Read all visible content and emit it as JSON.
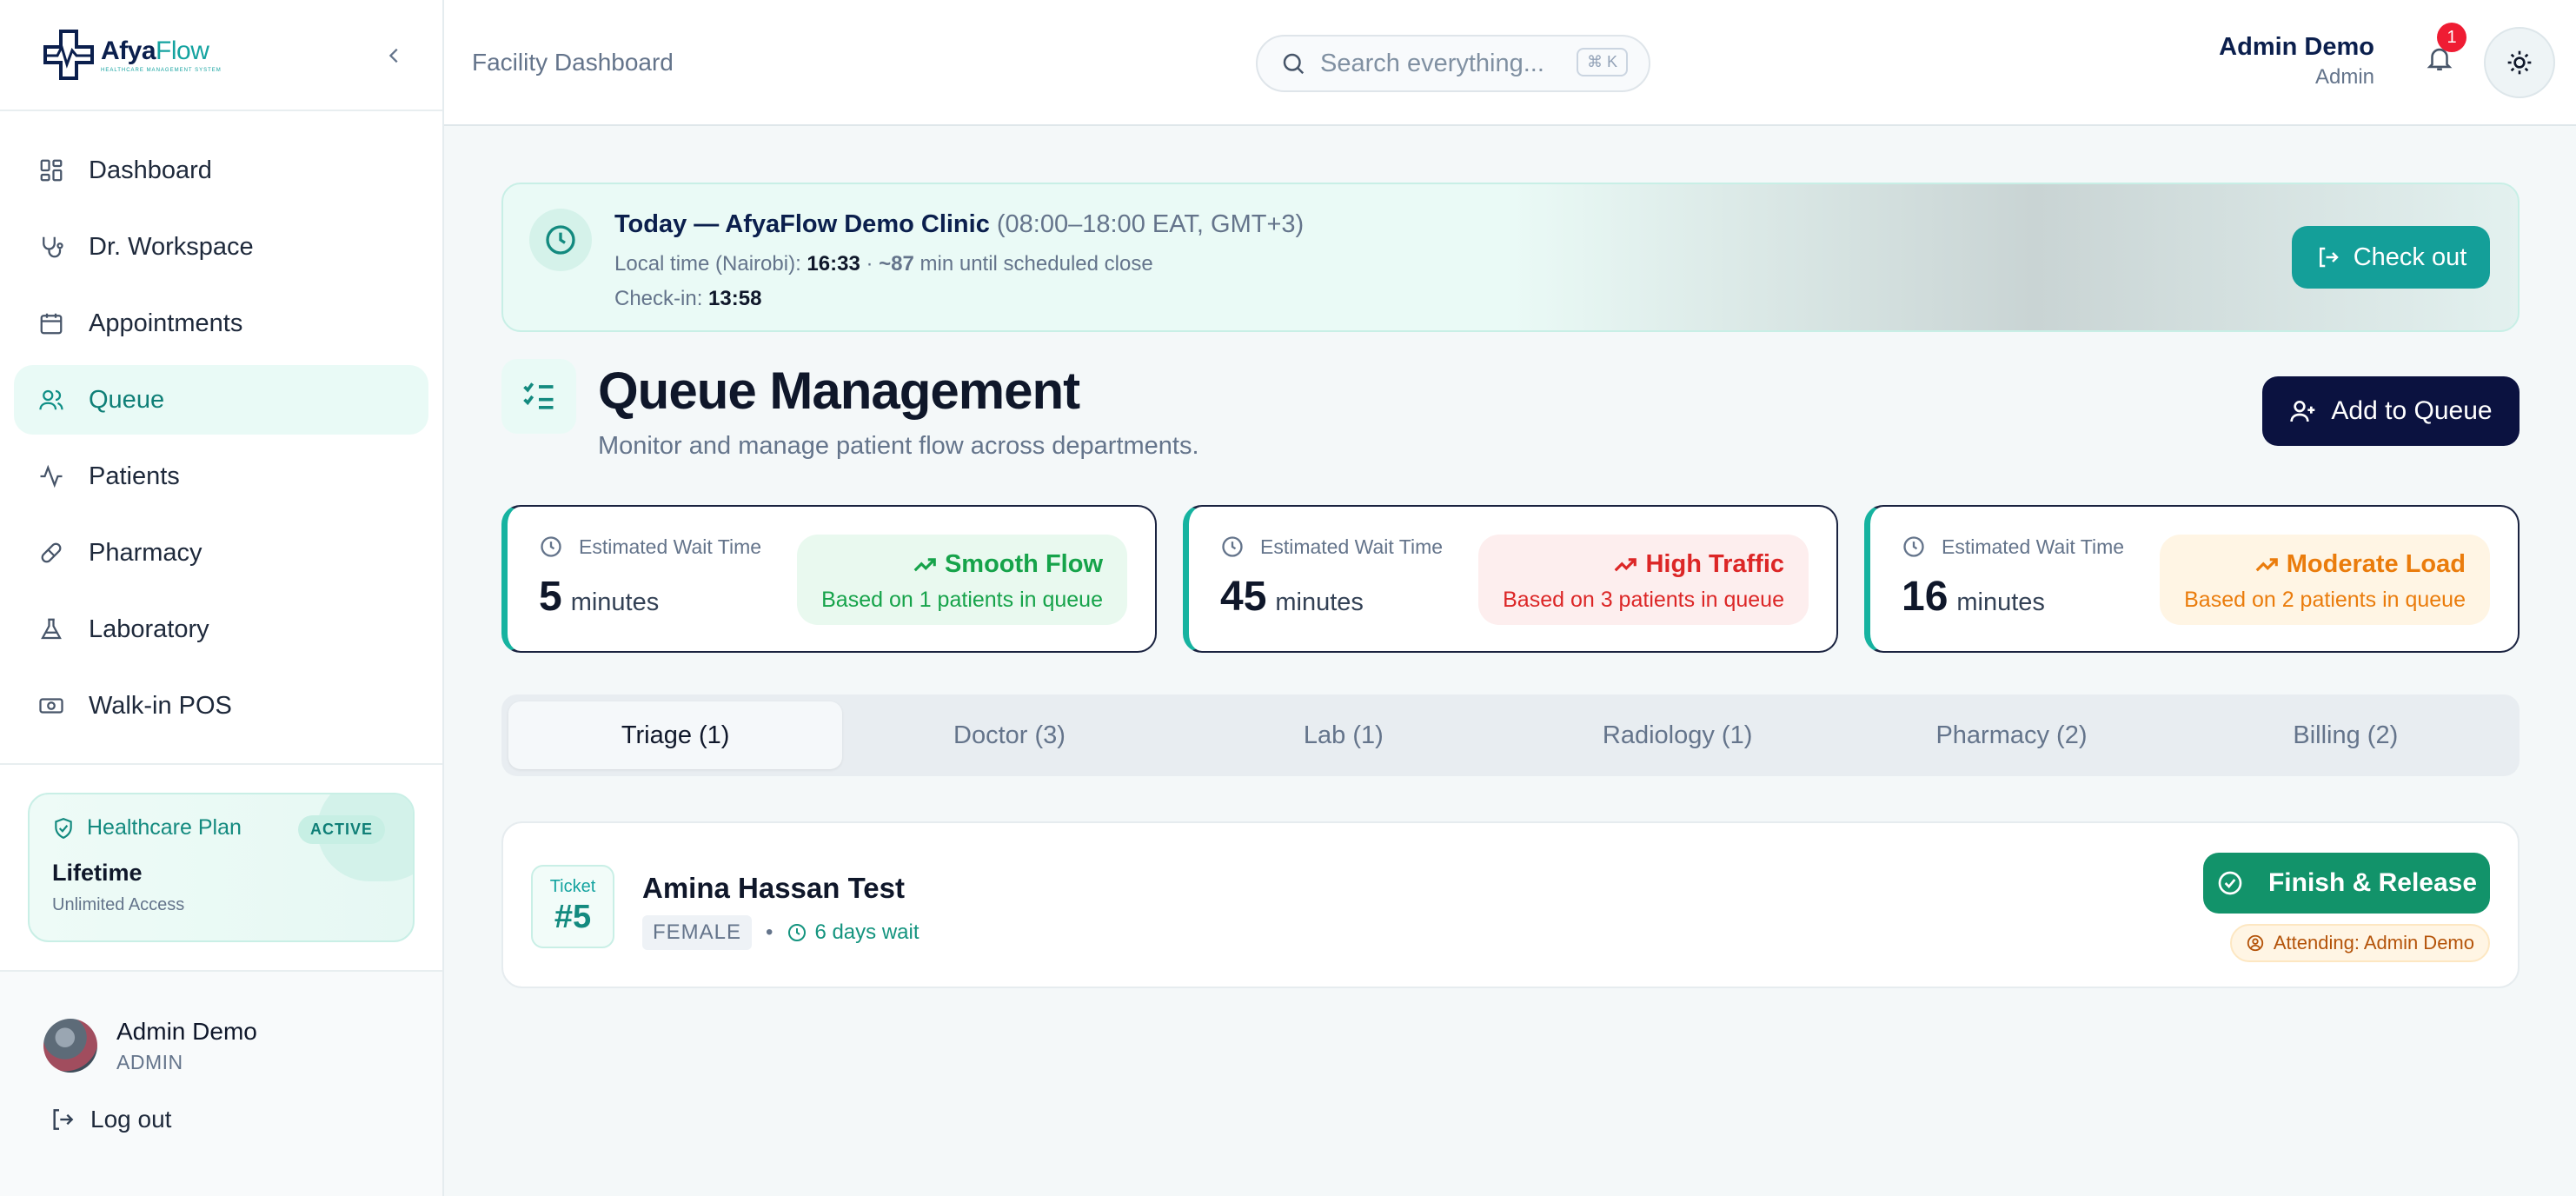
{
  "brand": {
    "name_a": "Afya",
    "name_b": "Flow",
    "tagline": "HEALTHCARE MANAGEMENT SYSTEM"
  },
  "sidebar": {
    "items": [
      {
        "label": "Dashboard",
        "icon": "grid-icon"
      },
      {
        "label": "Dr. Workspace",
        "icon": "stethoscope-icon"
      },
      {
        "label": "Appointments",
        "icon": "calendar-icon"
      },
      {
        "label": "Queue",
        "icon": "users-icon",
        "active": true
      },
      {
        "label": "Patients",
        "icon": "activity-icon"
      },
      {
        "label": "Pharmacy",
        "icon": "pill-icon"
      },
      {
        "label": "Laboratory",
        "icon": "flask-icon"
      },
      {
        "label": "Walk-in POS",
        "icon": "cash-icon"
      }
    ],
    "plan": {
      "title": "Healthcare Plan",
      "badge": "ACTIVE",
      "name": "Lifetime",
      "desc": "Unlimited Access"
    },
    "user": {
      "name": "Admin Demo",
      "role": "ADMIN"
    },
    "logout": "Log out"
  },
  "header": {
    "crumb": "Facility Dashboard",
    "search_placeholder": "Search everything...",
    "search_kbd": "⌘ K",
    "user_name": "Admin Demo",
    "user_role": "Admin",
    "notifications": "1"
  },
  "banner": {
    "title": "Today — AfyaFlow Demo Clinic",
    "hours": "(08:00–18:00 EAT, GMT+3)",
    "local_label": "Local time (Nairobi): ",
    "local_time": "16:33",
    "sep": " · ",
    "until": "~87",
    "until_suffix": " min until scheduled close",
    "checkin_label": "Check-in: ",
    "checkin_time": "13:58",
    "checkout_label": "Check out"
  },
  "queue": {
    "title": "Queue Management",
    "subtitle": "Monitor and manage patient flow across departments.",
    "add_label": "Add to Queue"
  },
  "cards": [
    {
      "label": "Estimated Wait Time",
      "value": "5",
      "unit": "minutes",
      "status": "Smooth Flow",
      "desc": "Based on 1 patients in queue",
      "tone": "green"
    },
    {
      "label": "Estimated Wait Time",
      "value": "45",
      "unit": "minutes",
      "status": "High Traffic",
      "desc": "Based on 3 patients in queue",
      "tone": "red"
    },
    {
      "label": "Estimated Wait Time",
      "value": "16",
      "unit": "minutes",
      "status": "Moderate Load",
      "desc": "Based on 2 patients in queue",
      "tone": "orange"
    }
  ],
  "tabs": [
    "Triage (1)",
    "Doctor (3)",
    "Lab (1)",
    "Radiology (1)",
    "Pharmacy (2)",
    "Billing (2)"
  ],
  "item": {
    "ticket_label": "Ticket",
    "ticket_no": "#5",
    "name": "Amina Hassan Test",
    "gender": "FEMALE",
    "dot": "•",
    "wait": "6 days wait",
    "finish": "Finish & Release",
    "attending": "Attending: Admin Demo"
  }
}
